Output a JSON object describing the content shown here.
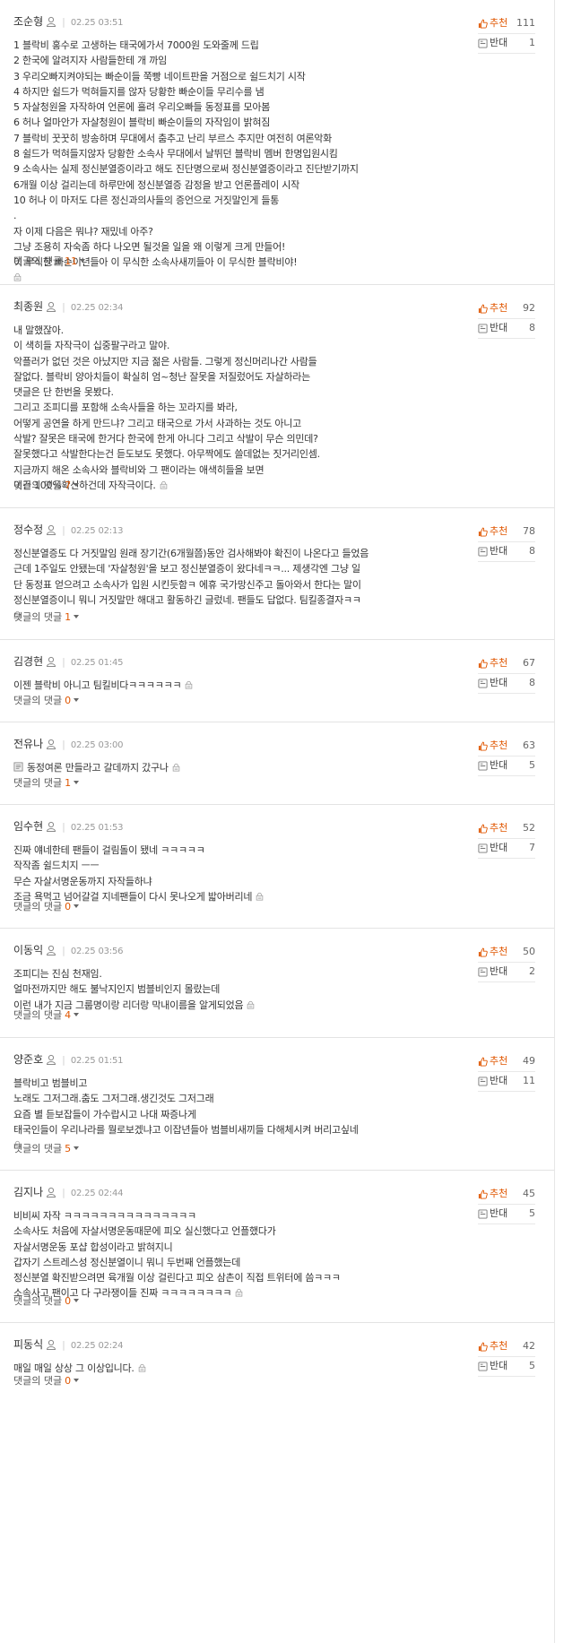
{
  "labels": {
    "recommend": "추천",
    "oppose": "반대",
    "replies": "댓글의 댓글"
  },
  "colors": {
    "accent": "#e05600",
    "muted": "#999999",
    "text": "#333333"
  },
  "comments": [
    {
      "author": "조순형",
      "date": "02.25 03:51",
      "up": "111",
      "down": "1",
      "replies": "11",
      "lines": [
        {
          "t": "1 블락비 홍수로 고생하는 태국에가서 7000원 도와줄께 드립",
          "lock": false
        },
        {
          "t": "2 한국에 알려지자 사람들한테 개 까임",
          "lock": false
        },
        {
          "t": "3 우리오빠지켜야되는 빠순이들 쭉빵 네이트판을 거점으로 쉴드치기 시작",
          "lock": false
        },
        {
          "t": "4 하지만 쉴드가 먹혀들지를 않자 당황한 빠순이들 무리수를 냄",
          "lock": false
        },
        {
          "t": "5 자살청원을 자작하여 언론에 흘려 우리오빠들 동정표를 모아봄",
          "lock": false
        },
        {
          "t": "6 허나 얼마안가 자살청원이 블락비 빠순이들의 자작임이 밝혀짐",
          "lock": false
        },
        {
          "t": "7 블락비 꿋꿋히 방송하며 무대에서 춤추고 난리 부르스 추지만 여전히 여론악화",
          "lock": false
        },
        {
          "t": "8 쉴드가 먹혀들지않자 당황한 소속사 무대에서 날뛰던 블락비 멤버 한명입원시킴",
          "lock": false
        },
        {
          "t": "9 소속사는 실제 정신분열증이라고 해도 진단명으로써 정신분열증이라고 진단받기까지",
          "lock": false
        },
        {
          "t": "6개월 이상 걸리는데 하루만에 정신분열증 감정을 받고 언론플레이 시작",
          "lock": false
        },
        {
          "t": "10 허나 이 마저도 다른 정신과의사들의 증언으로 거짓말인게 들통",
          "lock": false
        },
        {
          "t": ".",
          "lock": false
        },
        {
          "t": "자 이제 다음은 뭐냐? 재밌네 아주?",
          "lock": false
        },
        {
          "t": "그냥 조용히 자숙좀 하다 나오면 될것을 일을 왜 이렇게 크게 만들어!",
          "lock": false
        },
        {
          "t": "이 무식한 빠순이년들아 이 무식한 소속사새끼들아 이 무식한 블락비야!",
          "lock": false
        },
        {
          "t": "",
          "lock": true
        }
      ]
    },
    {
      "author": "최종원",
      "date": "02.25 02:34",
      "up": "92",
      "down": "8",
      "replies": "7",
      "lines": [
        {
          "t": "내 말했잖아.",
          "lock": false
        },
        {
          "t": "이 색히들 자작극이 십중팔구라고 말야.",
          "lock": false
        },
        {
          "t": "악플러가 없던 것은 아냤지만 지금 젊은 사람들. 그렇게 정신머리나간 사람들",
          "lock": false
        },
        {
          "t": "잘없다. 블락비 양아치들이 확실히 엄~청난 잘못을 저질렀어도 자살하라는",
          "lock": false
        },
        {
          "t": "댓글은 단 한번을 못봤다.",
          "lock": false
        },
        {
          "t": "그리고 조피디를 포함해 소속사들을 하는 꼬라지를 봐라,",
          "lock": false
        },
        {
          "t": "어떻게 공연을 하게 만드냐? 그리고 태국으로 가서 사과하는 것도 아니고",
          "lock": false
        },
        {
          "t": "삭발? 잘못은 태국에 한거다 한국에 한게 아니다 그리고 삭발이 무슨 의민데?",
          "lock": false
        },
        {
          "t": "잘못했다고 삭발한다는건 듣도보도 못했다. 아무짝에도 쓸데없는 짓거리인셈.",
          "lock": false
        },
        {
          "t": "지금까지 해온 소속사와 블락비와 그 팬이라는 애색히들을 보면",
          "lock": false
        },
        {
          "t": "이건 100%확신하건데 자작극이다.",
          "lock": true
        }
      ]
    },
    {
      "author": "정수정",
      "date": "02.25 02:13",
      "up": "78",
      "down": "8",
      "replies": "1",
      "lines": [
        {
          "t": "정신분열증도 다 거짓말임 원래 장기간(6개월쯤)동안 검사해봐야 확진이 나온다고 들었음",
          "lock": false
        },
        {
          "t": "근데 1주일도 안됐는데 '자살청원'을 보고 정신분열증이 왔다네ㅋㅋ... 제생각엔 그냥 일",
          "lock": false
        },
        {
          "t": "단 동정표 얻으려고 소속사가 입원 시킨듯함ㅋ 에휴 국가망신주고 돌아와서 한다는 말이",
          "lock": false
        },
        {
          "t": "정신분열증이니 뭐니 거짓말만 해대고 활동하긴 글렀네. 팬들도 답없다. 팀킬종결자ㅋㅋ",
          "lock": false
        },
        {
          "t": "",
          "lock": true
        }
      ]
    },
    {
      "author": "김경현",
      "date": "02.25 01:45",
      "up": "67",
      "down": "8",
      "replies": "0",
      "lines": [
        {
          "t": "이젠 블락비 아니고 팀킬비다ㅋㅋㅋㅋㅋㅋ",
          "lock": true
        }
      ]
    },
    {
      "author": "전유나",
      "date": "02.25 03:00",
      "up": "63",
      "down": "5",
      "replies": "1",
      "lines": [
        {
          "t": "동정여론 만들라고 갈데까지 갔구나",
          "lock": true,
          "memo": true
        }
      ]
    },
    {
      "author": "임수현",
      "date": "02.25 01:53",
      "up": "52",
      "down": "7",
      "replies": "0",
      "lines": [
        {
          "t": "진짜 얘네한테 팬들이 걸림돌이 됐네 ㅋㅋㅋㅋㅋ",
          "lock": false
        },
        {
          "t": "작작좀 쉴드치지 ㅡㅡ",
          "lock": false
        },
        {
          "t": "무슨 자살서명운동까지 자작들하냐",
          "lock": false
        },
        {
          "t": "조금 욕먹고 넘어갈걸 지네팬들이 다시 못나오게 밟아버리네",
          "lock": true
        }
      ]
    },
    {
      "author": "이동익",
      "date": "02.25 03:56",
      "up": "50",
      "down": "2",
      "replies": "4",
      "lines": [
        {
          "t": "조피디는 진심 천재임.",
          "lock": false
        },
        {
          "t": "얼마전까지만 해도 불낙지인지 범블비인지 몰랐는데",
          "lock": false
        },
        {
          "t": "이런 내가 지금 그룹명이랑 리더랑 막내이름을 알게되었음",
          "lock": true
        }
      ]
    },
    {
      "author": "양준호",
      "date": "02.25 01:51",
      "up": "49",
      "down": "11",
      "replies": "5",
      "lines": [
        {
          "t": "블락비고 범블비고",
          "lock": false
        },
        {
          "t": "노래도 그저그래.춤도 그저그래.생긴것도 그저그래",
          "lock": false
        },
        {
          "t": "요즘 별 듣보잡들이 가수랍시고 나대 짜증나게",
          "lock": false
        },
        {
          "t": "태국인들이 우리나라를 뭘로보겠냐고 이잡년들아 범블비새끼들 다해체시켜 버리고싶네",
          "lock": false
        },
        {
          "t": "",
          "lock": true
        }
      ]
    },
    {
      "author": "김지나",
      "date": "02.25 02:44",
      "up": "45",
      "down": "5",
      "replies": "0",
      "lines": [
        {
          "t": "비비씨 자작 ㅋㅋㅋㅋㅋㅋㅋㅋㅋㅋㅋㅋㅋㅋㅋ",
          "lock": false
        },
        {
          "t": "소속사도 처음에 자살서명운동때문에 피오 실신했다고 언플했다가",
          "lock": false
        },
        {
          "t": "자살서명운동 포샵 합성이라고 밝혀지니",
          "lock": false
        },
        {
          "t": "갑자기 스트레스성 정신분열이니 뭐니 두번째 언플했는데",
          "lock": false
        },
        {
          "t": "정신분열 확진받으려면 육개월 이상 걸린다고 피오 삼촌이 직접 트위터에 씀ㅋㅋㅋ",
          "lock": false
        },
        {
          "t": "소속사고 팬이고 다 구라쟁이들 진짜 ㅋㅋㅋㅋㅋㅋㅋㅋ",
          "lock": true
        }
      ]
    },
    {
      "author": "피동식",
      "date": "02.25 02:24",
      "up": "42",
      "down": "5",
      "replies": "0",
      "lines": [
        {
          "t": "매일 매일 상상 그 이상입니다.",
          "lock": true
        }
      ]
    }
  ]
}
